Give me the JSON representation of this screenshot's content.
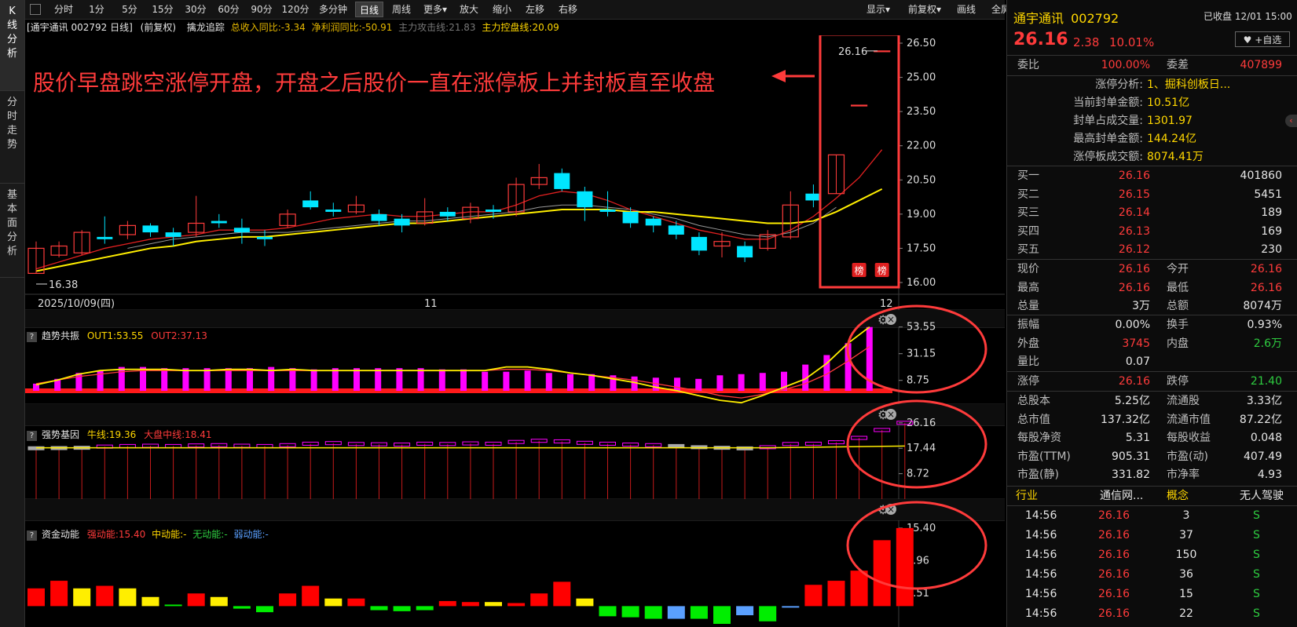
{
  "left_tabs": [
    "K线分析",
    "分时走势",
    "基本面分析"
  ],
  "toolbar": {
    "periods": [
      "分时",
      "1分",
      "5分",
      "15分",
      "30分",
      "60分",
      "90分",
      "120分",
      "多分钟",
      "日线",
      "周线",
      "更多▾",
      "放大",
      "缩小",
      "左移",
      "右移"
    ],
    "active": "日线",
    "right": [
      "显示▾",
      "前复权▾",
      "画线",
      "全屏"
    ]
  },
  "info_line": {
    "stock": "[通宇通讯 002792 日线]",
    "adj": "(前复权)",
    "indicator": "擒龙追踪",
    "rev": "总收入同比:-3.34",
    "profit": "净利润同比:-50.91",
    "attack": "主力攻击线:21.83",
    "control": "主力控盘线:20.09"
  },
  "annotation": "股价早盘跳空涨停开盘，开盘之后股价一直在涨停板上并封板直至收盘",
  "chart_data": [
    {
      "type": "candlestick",
      "title": "通宇通讯 002792 日线",
      "y_ticks": [
        "26.50",
        "25.00",
        "23.50",
        "22.00",
        "20.50",
        "19.00",
        "17.50",
        "16.00"
      ],
      "ylim": [
        16.0,
        26.5
      ],
      "x_labels": [
        "2025/10/09(四)",
        "11",
        "12"
      ],
      "low_label": "16.38",
      "high_label": "26.16",
      "badges": [
        "榜",
        "榜"
      ],
      "candles": [
        {
          "o": 16.4,
          "c": 17.5,
          "h": 17.8,
          "l": 16.38
        },
        {
          "o": 17.2,
          "c": 17.6,
          "h": 17.8,
          "l": 17.1
        },
        {
          "o": 17.3,
          "c": 18.2,
          "h": 18.3,
          "l": 17.2
        },
        {
          "o": 18.0,
          "c": 17.9,
          "h": 18.9,
          "l": 17.7
        },
        {
          "o": 18.1,
          "c": 18.5,
          "h": 18.7,
          "l": 17.9
        },
        {
          "o": 18.5,
          "c": 18.2,
          "h": 18.6,
          "l": 18.0
        },
        {
          "o": 18.2,
          "c": 18.0,
          "h": 18.4,
          "l": 17.6
        },
        {
          "o": 18.2,
          "c": 18.6,
          "h": 19.8,
          "l": 18.0
        },
        {
          "o": 18.7,
          "c": 18.6,
          "h": 19.0,
          "l": 18.4
        },
        {
          "o": 18.4,
          "c": 18.2,
          "h": 18.8,
          "l": 17.7
        },
        {
          "o": 18.0,
          "c": 17.9,
          "h": 18.3,
          "l": 17.6
        },
        {
          "o": 18.5,
          "c": 19.0,
          "h": 19.2,
          "l": 18.4
        },
        {
          "o": 19.6,
          "c": 19.3,
          "h": 20.0,
          "l": 19.2
        },
        {
          "o": 19.2,
          "c": 19.1,
          "h": 19.5,
          "l": 18.9
        },
        {
          "o": 19.1,
          "c": 19.4,
          "h": 19.8,
          "l": 19.0
        },
        {
          "o": 19.0,
          "c": 18.7,
          "h": 19.2,
          "l": 18.5
        },
        {
          "o": 18.8,
          "c": 18.5,
          "h": 19.0,
          "l": 18.2
        },
        {
          "o": 18.6,
          "c": 19.1,
          "h": 19.7,
          "l": 18.5
        },
        {
          "o": 19.1,
          "c": 18.9,
          "h": 19.3,
          "l": 18.7
        },
        {
          "o": 18.8,
          "c": 19.3,
          "h": 19.5,
          "l": 18.6
        },
        {
          "o": 19.2,
          "c": 19.1,
          "h": 19.4,
          "l": 18.8
        },
        {
          "o": 19.1,
          "c": 20.3,
          "h": 20.6,
          "l": 18.9
        },
        {
          "o": 20.3,
          "c": 20.6,
          "h": 21.2,
          "l": 20.1
        },
        {
          "o": 20.8,
          "c": 20.1,
          "h": 21.0,
          "l": 20.0
        },
        {
          "o": 20.0,
          "c": 19.3,
          "h": 20.2,
          "l": 18.7
        },
        {
          "o": 19.2,
          "c": 19.1,
          "h": 20.0,
          "l": 18.9
        },
        {
          "o": 19.1,
          "c": 18.6,
          "h": 19.3,
          "l": 18.4
        },
        {
          "o": 18.8,
          "c": 18.5,
          "h": 18.9,
          "l": 18.2
        },
        {
          "o": 18.5,
          "c": 18.1,
          "h": 18.7,
          "l": 17.9
        },
        {
          "o": 18.0,
          "c": 17.4,
          "h": 18.2,
          "l": 17.2
        },
        {
          "o": 17.6,
          "c": 17.8,
          "h": 18.2,
          "l": 17.1
        },
        {
          "o": 17.6,
          "c": 17.1,
          "h": 17.8,
          "l": 16.9
        },
        {
          "o": 17.5,
          "c": 18.1,
          "h": 18.3,
          "l": 17.4
        },
        {
          "o": 18.0,
          "c": 19.4,
          "h": 20.0,
          "l": 17.9
        },
        {
          "o": 19.9,
          "c": 19.6,
          "h": 20.3,
          "l": 19.3
        },
        {
          "o": 19.9,
          "c": 21.6,
          "h": 21.6,
          "l": 19.9
        },
        {
          "o": 23.78,
          "c": 23.78,
          "h": 23.78,
          "l": 23.78
        },
        {
          "o": 26.16,
          "c": 26.16,
          "h": 26.16,
          "l": 26.16
        }
      ],
      "ma_yellow": [
        16.5,
        16.7,
        16.9,
        17.1,
        17.3,
        17.5,
        17.6,
        17.8,
        17.9,
        18.0,
        18.0,
        18.1,
        18.2,
        18.3,
        18.4,
        18.5,
        18.6,
        18.6,
        18.7,
        18.8,
        18.9,
        19.0,
        19.1,
        19.2,
        19.2,
        19.2,
        19.1,
        19.1,
        19.0,
        18.9,
        18.8,
        18.7,
        18.6,
        18.6,
        18.7,
        19.1,
        19.6,
        20.1
      ],
      "ma_red": [
        16.6,
        16.9,
        17.2,
        17.5,
        17.7,
        17.9,
        18.0,
        18.1,
        18.3,
        18.3,
        18.3,
        18.4,
        18.6,
        18.8,
        18.9,
        19.0,
        18.9,
        18.9,
        19.0,
        19.1,
        19.1,
        19.4,
        19.8,
        20.0,
        19.9,
        19.6,
        19.2,
        18.9,
        18.6,
        18.3,
        18.1,
        17.9,
        17.9,
        18.3,
        18.9,
        19.7,
        20.6,
        21.83
      ],
      "ma_gray": [
        null,
        null,
        null,
        null,
        17.5,
        17.7,
        17.9,
        18.0,
        18.1,
        18.2,
        18.2,
        18.2,
        18.3,
        18.4,
        18.5,
        18.6,
        18.7,
        18.7,
        18.8,
        18.9,
        19.0,
        19.1,
        19.3,
        19.4,
        19.4,
        19.3,
        19.2,
        19.0,
        18.8,
        18.5,
        18.3,
        18.1,
        18.0,
        18.2,
        18.6,
        19.3,
        null,
        null
      ]
    },
    {
      "type": "bar",
      "title": "趋势共振",
      "series_labels": [
        "OUT1:53.55",
        "OUT2:37.13"
      ],
      "y_ticks": [
        "53.55",
        "31.15",
        "8.75"
      ],
      "ylim": [
        0,
        56
      ],
      "values": [
        6,
        10,
        15,
        17,
        20,
        20,
        19,
        19,
        19,
        19,
        19,
        20,
        19,
        18,
        19,
        19,
        19,
        19,
        19,
        18,
        18,
        16,
        16,
        17,
        15,
        14,
        14,
        13,
        12,
        11,
        11,
        10,
        13,
        14,
        15,
        16,
        22,
        30,
        40,
        53.55
      ],
      "line_yellow": [
        5,
        9,
        14,
        17,
        18,
        18,
        18,
        17,
        17,
        18,
        18,
        17,
        18,
        17,
        17,
        17,
        17,
        17,
        17,
        17,
        17,
        17,
        20,
        20,
        18,
        15,
        13,
        10,
        7,
        3,
        0,
        -4,
        -8,
        -10,
        -4,
        3,
        10,
        23,
        40,
        53.55
      ],
      "line_red": [
        6,
        9,
        12,
        14,
        16,
        17,
        17,
        17,
        17,
        17,
        17,
        17,
        17,
        17,
        17,
        17,
        17,
        17,
        17,
        17,
        17,
        17,
        18,
        18,
        17,
        15,
        13,
        11,
        9,
        6,
        3,
        0,
        -4,
        -6,
        -3,
        1,
        6,
        14,
        25,
        37.13
      ]
    },
    {
      "type": "bar",
      "title": "强势基因",
      "series_labels": [
        "牛线:19.36",
        "大盘中线:18.41"
      ],
      "y_ticks": [
        "26.16",
        "17.44",
        "8.72"
      ],
      "ylim": [
        0,
        28
      ],
      "values": [
        17.44,
        17.5,
        17.6,
        18.0,
        18.2,
        18.3,
        18.2,
        18.4,
        18.5,
        18.3,
        18.2,
        18.5,
        19.0,
        19.2,
        18.9,
        18.8,
        18.7,
        19.0,
        18.9,
        19.1,
        19.0,
        19.6,
        20.0,
        19.8,
        19.3,
        19.0,
        18.7,
        18.5,
        18.2,
        17.8,
        17.6,
        17.4,
        17.8,
        18.9,
        19.0,
        19.5,
        21.0,
        23.7,
        26.16
      ]
    },
    {
      "type": "bar",
      "title": "资金动能",
      "series_labels": [
        "强动能:15.40",
        "中动能:-",
        "无动能:-",
        "弱动能:-"
      ],
      "y_ticks": [
        "15.40",
        "8.96",
        "2.51"
      ],
      "ylim": [
        -3.5,
        16
      ],
      "values": [
        3.5,
        5.0,
        3.5,
        4.0,
        3.5,
        1.8,
        0.3,
        2.5,
        1.8,
        -0.5,
        -1.2,
        2.5,
        4.0,
        1.5,
        1.5,
        -0.8,
        -1.0,
        -0.8,
        1.0,
        0.8,
        0.8,
        0.6,
        2.5,
        4.8,
        1.5,
        -2.0,
        -2.2,
        -2.5,
        -2.5,
        -2.5,
        -3.5,
        -1.8,
        -3.0,
        -0.3,
        4.2,
        5.0,
        7.0,
        13.0,
        15.4
      ],
      "colors": [
        "red",
        "red",
        "yellow",
        "red",
        "yellow",
        "yellow",
        "green",
        "red",
        "yellow",
        "green",
        "green",
        "red",
        "red",
        "yellow",
        "red",
        "green",
        "green",
        "green",
        "red",
        "red",
        "yellow",
        "red",
        "red",
        "red",
        "yellow",
        "green",
        "green",
        "green",
        "blue",
        "green",
        "green",
        "blue",
        "green",
        "blue",
        "red",
        "red",
        "red",
        "red",
        "red"
      ]
    }
  ],
  "quote": {
    "name": "通宇通讯",
    "code": "002792",
    "status": "已收盘 12/01 15:00",
    "price": "26.16",
    "change": "2.38",
    "pct": "10.01%",
    "watch": "+自选",
    "weibi_label": "委比",
    "weibi": "100.00%",
    "weicha_label": "委差",
    "weicha": "407899",
    "limit_info": [
      {
        "k": "涨停分析:",
        "v": "1、掘科创板日..."
      },
      {
        "k": "当前封单金额:",
        "v": "10.51亿"
      },
      {
        "k": "封单占成交量:",
        "v": "1301.97"
      },
      {
        "k": "最高封单金额:",
        "v": "144.24亿"
      },
      {
        "k": "涨停板成交额:",
        "v": "8074.41万"
      }
    ],
    "bids": [
      {
        "label": "买一",
        "price": "26.16",
        "vol": "401860"
      },
      {
        "label": "买二",
        "price": "26.15",
        "vol": "5451"
      },
      {
        "label": "买三",
        "price": "26.14",
        "vol": "189"
      },
      {
        "label": "买四",
        "price": "26.13",
        "vol": "169"
      },
      {
        "label": "买五",
        "price": "26.12",
        "vol": "230"
      }
    ],
    "stats1": [
      {
        "k1": "现价",
        "v1": "26.16",
        "c1": "red",
        "k2": "今开",
        "v2": "26.16",
        "c2": "red"
      },
      {
        "k1": "最高",
        "v1": "26.16",
        "c1": "red",
        "k2": "最低",
        "v2": "26.16",
        "c2": "red"
      },
      {
        "k1": "总量",
        "v1": "3万",
        "c1": "white",
        "k2": "总额",
        "v2": "8074万",
        "c2": "white"
      }
    ],
    "stats2": [
      {
        "k1": "振幅",
        "v1": "0.00%",
        "c1": "white",
        "k2": "换手",
        "v2": "0.93%",
        "c2": "white"
      },
      {
        "k1": "外盘",
        "v1": "3745",
        "c1": "red",
        "k2": "内盘",
        "v2": "2.6万",
        "c2": "green"
      },
      {
        "k1": "量比",
        "v1": "0.07",
        "c1": "white",
        "k2": "",
        "v2": "",
        "c2": "white"
      }
    ],
    "stats3": [
      {
        "k1": "涨停",
        "v1": "26.16",
        "c1": "red",
        "k2": "跌停",
        "v2": "21.40",
        "c2": "green"
      }
    ],
    "stats4": [
      {
        "k1": "总股本",
        "v1": "5.25亿",
        "c1": "white",
        "k2": "流通股",
        "v2": "3.33亿",
        "c2": "white"
      },
      {
        "k1": "总市值",
        "v1": "137.32亿",
        "c1": "white",
        "k2": "流通市值",
        "v2": "87.22亿",
        "c2": "white"
      },
      {
        "k1": "每股净资",
        "v1": "5.31",
        "c1": "white",
        "k2": "每股收益",
        "v2": "0.048",
        "c2": "white"
      },
      {
        "k1": "市盈(TTM)",
        "v1": "905.31",
        "c1": "white",
        "k2": "市盈(动)",
        "v2": "407.49",
        "c2": "white"
      },
      {
        "k1": "市盈(静)",
        "v1": "331.82",
        "c1": "white",
        "k2": "市净率",
        "v2": "4.93",
        "c2": "white"
      }
    ],
    "industry_label": "行业",
    "industry": "通信网...",
    "concept_label": "概念",
    "concept": "无人驾驶",
    "ticks": [
      {
        "t": "14:56",
        "p": "26.16",
        "v": "3",
        "s": "S"
      },
      {
        "t": "14:56",
        "p": "26.16",
        "v": "37",
        "s": "S"
      },
      {
        "t": "14:56",
        "p": "26.16",
        "v": "150",
        "s": "S"
      },
      {
        "t": "14:56",
        "p": "26.16",
        "v": "36",
        "s": "S"
      },
      {
        "t": "14:56",
        "p": "26.16",
        "v": "15",
        "s": "S"
      },
      {
        "t": "14:56",
        "p": "26.16",
        "v": "22",
        "s": "S"
      }
    ]
  },
  "colors": {
    "up": "#ff3b3b",
    "down": "#00e5ff",
    "yellow": "#ffee00",
    "magenta": "#ff00ff",
    "green": "#2ecc40",
    "blue": "#5aa0ff"
  }
}
